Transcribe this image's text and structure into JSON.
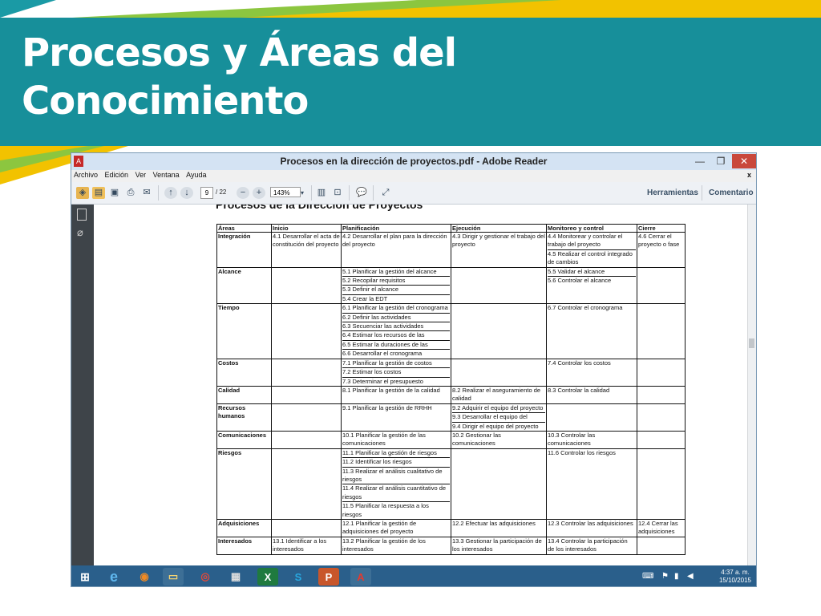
{
  "slide": {
    "title_line1": "Procesos y Áreas del",
    "title_line2": "Conocimiento"
  },
  "window": {
    "title": "Procesos en la dirección de proyectos.pdf - Adobe Reader",
    "minimize": "—",
    "maximize": "❐",
    "close": "✕"
  },
  "menu": {
    "items": [
      "Archivo",
      "Edición",
      "Ver",
      "Ventana",
      "Ayuda"
    ],
    "close": "x"
  },
  "toolbar": {
    "page_current": "9",
    "page_total": "/ 22",
    "zoom": "143%",
    "herramientas": "Herramientas",
    "comentario": "Comentario"
  },
  "document": {
    "heading": "Procesos de la Dirección de Proyectos",
    "columns": [
      "Áreas",
      "Inicio",
      "Planificación",
      "Ejecución",
      "Monitoreo y control",
      "Cierre"
    ],
    "rows": [
      {
        "area": "Integración",
        "inicio": [
          "4.1 Desarrollar el acta de constitución del proyecto"
        ],
        "planificacion": [
          "4.2 Desarrollar el plan para la dirección del proyecto"
        ],
        "ejecucion": [
          "4.3 Dirigir y gestionar el trabajo del proyecto"
        ],
        "monitoreo": [
          "4.4 Monitorear y controlar el trabajo del proyecto",
          "4.5 Realizar el control integrado de cambios"
        ],
        "cierre": [
          "4.6 Cerrar el proyecto o fase"
        ]
      },
      {
        "area": "Alcance",
        "inicio": [],
        "planificacion": [
          "5.1 Planificar la gestión del alcance",
          "5.2 Recopilar requisitos",
          "5.3 Definir el alcance",
          "5.4 Crear la EDT"
        ],
        "ejecucion": [],
        "monitoreo": [
          "5.5 Validar el alcance",
          "5.6 Controlar el alcance"
        ],
        "cierre": []
      },
      {
        "area": "Tiempo",
        "inicio": [],
        "planificacion": [
          "6.1 Planificar la gestión del cronograma",
          "6.2 Definir las actividades",
          "6.3 Secuenciar las actividades",
          "6.4 Estimar los recursos de las",
          "6.5 Estimar la duraciones de las",
          "6.6 Desarrollar el cronograma"
        ],
        "ejecucion": [],
        "monitoreo": [
          "6.7 Controlar el cronograma"
        ],
        "cierre": []
      },
      {
        "area": "Costos",
        "inicio": [],
        "planificacion": [
          "7.1 Planificar la gestión de costos",
          "7.2 Estimar los costos",
          "7.3 Determinar el presupuesto"
        ],
        "ejecucion": [],
        "monitoreo": [
          "7.4 Controlar los costos"
        ],
        "cierre": []
      },
      {
        "area": "Calidad",
        "inicio": [],
        "planificacion": [
          "8.1 Planificar la gestión de la calidad"
        ],
        "ejecucion": [
          "8.2 Realizar el aseguramiento de calidad"
        ],
        "monitoreo": [
          "8.3 Controlar la calidad"
        ],
        "cierre": []
      },
      {
        "area": "Recursos humanos",
        "inicio": [],
        "planificacion": [
          "9.1 Planificar la gestión de RRHH"
        ],
        "ejecucion": [
          "9.2 Adquirir el equipo del proyecto",
          "9.3 Desarrollar el equipo del",
          "9.4 Dirigir el equipo del proyecto"
        ],
        "monitoreo": [],
        "cierre": []
      },
      {
        "area": "Comunicaciones",
        "inicio": [],
        "planificacion": [
          "10.1 Planificar la gestión de las comunicaciones"
        ],
        "ejecucion": [
          "10.2 Gestionar las comunicaciones"
        ],
        "monitoreo": [
          "10.3 Controlar las comunicaciones"
        ],
        "cierre": []
      },
      {
        "area": "Riesgos",
        "inicio": [],
        "planificacion": [
          "11.1 Planificar la gestión de riesgos",
          "11.2 Identificar los riesgos",
          "11.3 Realizar el análisis cualitativo de riesgos",
          "11.4 Realizar el análisis cuantitativo de riesgos",
          "11.5 Planificar la respuesta a los riesgos"
        ],
        "ejecucion": [],
        "monitoreo": [
          "11.6 Controlar los riesgos"
        ],
        "cierre": []
      },
      {
        "area": "Adquisiciones",
        "inicio": [],
        "planificacion": [
          "12.1 Planificar la gestión de adquisiciones del proyecto"
        ],
        "ejecucion": [
          "12.2 Efectuar las adquisiciones"
        ],
        "monitoreo": [
          "12.3 Controlar las adquisiciones"
        ],
        "cierre": [
          "12.4 Cerrar las adquisiciones"
        ]
      },
      {
        "area": "Interesados",
        "inicio": [
          "13.1 Identificar a los interesados"
        ],
        "planificacion": [
          "13.2 Planificar la gestión de los interesados"
        ],
        "ejecucion": [
          "13.3 Gestionar la participación de los interesados"
        ],
        "monitoreo": [
          "13.4 Controlar la participación de los interesados"
        ],
        "cierre": []
      }
    ]
  },
  "taskbar": {
    "time": "4:37 a. m.",
    "date": "15/10/2015"
  },
  "colors": {
    "band": "#178f9a",
    "yellow": "#f2c200",
    "green": "#8cc63f",
    "taskbar": "#2a5f8b"
  }
}
